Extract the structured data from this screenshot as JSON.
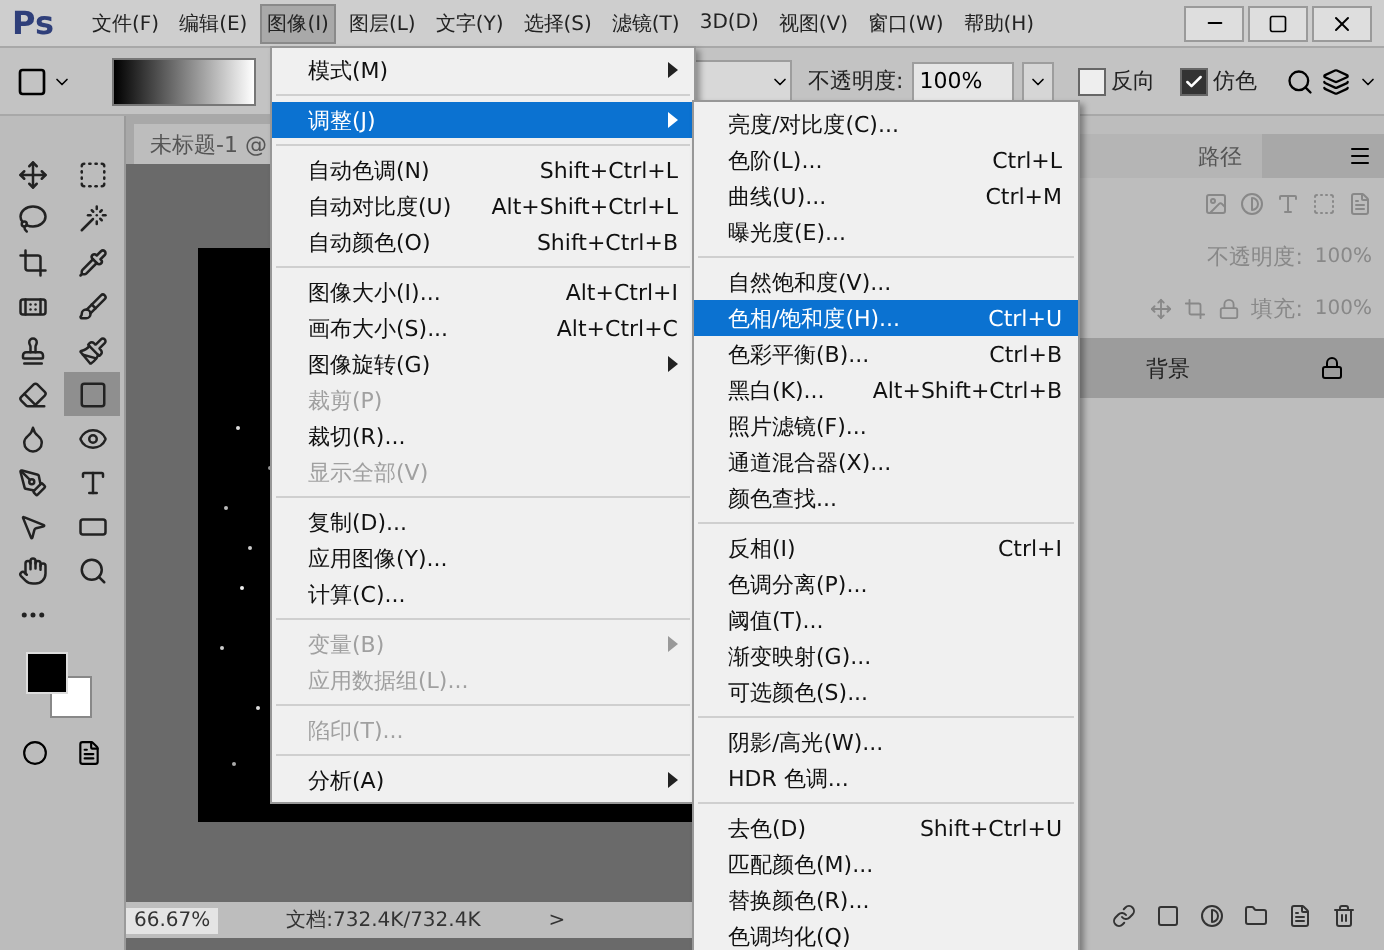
{
  "app_logo": "Ps",
  "menu_bar": [
    {
      "label": "文件(F)",
      "selected": false
    },
    {
      "label": "编辑(E)",
      "selected": false
    },
    {
      "label": "图像(I)",
      "selected": true
    },
    {
      "label": "图层(L)",
      "selected": false
    },
    {
      "label": "文字(Y)",
      "selected": false
    },
    {
      "label": "选择(S)",
      "selected": false
    },
    {
      "label": "滤镜(T)",
      "selected": false
    },
    {
      "label": "3D(D)",
      "selected": false
    },
    {
      "label": "视图(V)",
      "selected": false
    },
    {
      "label": "窗口(W)",
      "selected": false
    },
    {
      "label": "帮助(H)",
      "selected": false
    }
  ],
  "options_bar": {
    "opacity_label": "不透明度:",
    "opacity_value": "100%",
    "checkboxes": [
      {
        "label": "反向",
        "checked": false
      },
      {
        "label": "仿色",
        "checked": true
      }
    ]
  },
  "tools": [
    {
      "selected": false
    },
    {
      "selected": false
    },
    {
      "selected": false
    },
    {
      "selected": false
    },
    {
      "selected": false
    },
    {
      "selected": false
    },
    {
      "selected": false
    },
    {
      "selected": false
    },
    {
      "selected": false
    },
    {
      "selected": false
    },
    {
      "selected": false
    },
    {
      "selected": true
    },
    {
      "selected": false
    },
    {
      "selected": false
    },
    {
      "selected": false
    },
    {
      "selected": false
    },
    {
      "selected": false
    },
    {
      "selected": false
    },
    {
      "selected": false
    },
    {
      "selected": false
    }
  ],
  "document_tab": "未标题-1 @",
  "status_bar": {
    "zoom": "66.67%",
    "doc_info": "文档:732.4K/732.4K",
    "arrow": ">"
  },
  "image_menu": [
    {
      "kind": "item",
      "label": "模式(M)",
      "submenu": true,
      "disabled": false,
      "selected": false
    },
    {
      "kind": "separator"
    },
    {
      "kind": "item",
      "label": "调整(J)",
      "submenu": true,
      "disabled": false,
      "selected": true
    },
    {
      "kind": "separator"
    },
    {
      "kind": "item",
      "label": "自动色调(N)",
      "shortcut": "Shift+Ctrl+L",
      "submenu": false,
      "disabled": false,
      "selected": false
    },
    {
      "kind": "item",
      "label": "自动对比度(U)",
      "shortcut": "Alt+Shift+Ctrl+L",
      "submenu": false,
      "disabled": false,
      "selected": false
    },
    {
      "kind": "item",
      "label": "自动颜色(O)",
      "shortcut": "Shift+Ctrl+B",
      "submenu": false,
      "disabled": false,
      "selected": false
    },
    {
      "kind": "separator"
    },
    {
      "kind": "item",
      "label": "图像大小(I)...",
      "shortcut": "Alt+Ctrl+I",
      "submenu": false,
      "disabled": false,
      "selected": false
    },
    {
      "kind": "item",
      "label": "画布大小(S)...",
      "shortcut": "Alt+Ctrl+C",
      "submenu": false,
      "disabled": false,
      "selected": false
    },
    {
      "kind": "item",
      "label": "图像旋转(G)",
      "submenu": true,
      "disabled": false,
      "selected": false
    },
    {
      "kind": "item",
      "label": "裁剪(P)",
      "submenu": false,
      "disabled": true,
      "selected": false
    },
    {
      "kind": "item",
      "label": "裁切(R)...",
      "submenu": false,
      "disabled": false,
      "selected": false
    },
    {
      "kind": "item",
      "label": "显示全部(V)",
      "submenu": false,
      "disabled": true,
      "selected": false
    },
    {
      "kind": "separator"
    },
    {
      "kind": "item",
      "label": "复制(D)...",
      "submenu": false,
      "disabled": false,
      "selected": false
    },
    {
      "kind": "item",
      "label": "应用图像(Y)...",
      "submenu": false,
      "disabled": false,
      "selected": false
    },
    {
      "kind": "item",
      "label": "计算(C)...",
      "submenu": false,
      "disabled": false,
      "selected": false
    },
    {
      "kind": "separator"
    },
    {
      "kind": "item",
      "label": "变量(B)",
      "submenu": true,
      "disabled": true,
      "selected": false
    },
    {
      "kind": "item",
      "label": "应用数据组(L)...",
      "submenu": false,
      "disabled": true,
      "selected": false
    },
    {
      "kind": "separator"
    },
    {
      "kind": "item",
      "label": "陷印(T)...",
      "submenu": false,
      "disabled": true,
      "selected": false
    },
    {
      "kind": "separator"
    },
    {
      "kind": "item",
      "label": "分析(A)",
      "submenu": true,
      "disabled": false,
      "selected": false
    }
  ],
  "adjust_menu": [
    {
      "kind": "item",
      "label": "亮度/对比度(C)...",
      "selected": false
    },
    {
      "kind": "item",
      "label": "色阶(L)...",
      "shortcut": "Ctrl+L",
      "selected": false
    },
    {
      "kind": "item",
      "label": "曲线(U)...",
      "shortcut": "Ctrl+M",
      "selected": false
    },
    {
      "kind": "item",
      "label": "曝光度(E)...",
      "selected": false
    },
    {
      "kind": "separator"
    },
    {
      "kind": "item",
      "label": "自然饱和度(V)...",
      "selected": false
    },
    {
      "kind": "item",
      "label": "色相/饱和度(H)...",
      "shortcut": "Ctrl+U",
      "selected": true
    },
    {
      "kind": "item",
      "label": "色彩平衡(B)...",
      "shortcut": "Ctrl+B",
      "selected": false
    },
    {
      "kind": "item",
      "label": "黑白(K)...",
      "shortcut": "Alt+Shift+Ctrl+B",
      "selected": false
    },
    {
      "kind": "item",
      "label": "照片滤镜(F)...",
      "selected": false
    },
    {
      "kind": "item",
      "label": "通道混合器(X)...",
      "selected": false
    },
    {
      "kind": "item",
      "label": "颜色查找...",
      "selected": false
    },
    {
      "kind": "separator"
    },
    {
      "kind": "item",
      "label": "反相(I)",
      "shortcut": "Ctrl+I",
      "selected": false
    },
    {
      "kind": "item",
      "label": "色调分离(P)...",
      "selected": false
    },
    {
      "kind": "item",
      "label": "阈值(T)...",
      "selected": false
    },
    {
      "kind": "item",
      "label": "渐变映射(G)...",
      "selected": false
    },
    {
      "kind": "item",
      "label": "可选颜色(S)...",
      "selected": false
    },
    {
      "kind": "separator"
    },
    {
      "kind": "item",
      "label": "阴影/高光(W)...",
      "selected": false
    },
    {
      "kind": "item",
      "label": "HDR 色调...",
      "selected": false
    },
    {
      "kind": "separator"
    },
    {
      "kind": "item",
      "label": "去色(D)",
      "shortcut": "Shift+Ctrl+U",
      "selected": false
    },
    {
      "kind": "item",
      "label": "匹配颜色(M)...",
      "selected": false
    },
    {
      "kind": "item",
      "label": "替换颜色(R)...",
      "selected": false
    },
    {
      "kind": "item",
      "label": "色调均化(Q)",
      "selected": false
    }
  ],
  "layers_panel": {
    "tab": "路径",
    "opacity_label": "不透明度:",
    "opacity_value": "100%",
    "fill_label": "填充:",
    "fill_value": "100%",
    "layers": [
      {
        "name": "背景",
        "locked": true
      }
    ]
  }
}
